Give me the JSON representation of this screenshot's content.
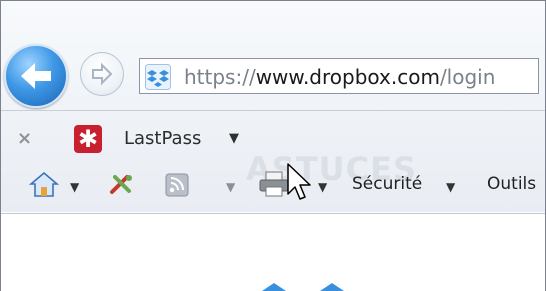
{
  "toolbar": {
    "back_icon": "back-arrow-icon",
    "forward_icon": "forward-arrow-icon",
    "address": {
      "site_icon": "dropbox-icon",
      "url_scheme": "https://",
      "url_host": "www.dropbox.com",
      "url_path": "/login"
    }
  },
  "lastpass_bar": {
    "close": "×",
    "logo_glyph": "✱",
    "label": "LastPass",
    "caret": "▼"
  },
  "command_bar": {
    "home_icon": "home-icon",
    "feeds_icon": "rss-feed-icon",
    "print_icon": "printer-icon",
    "tools_icon": "tools-icon",
    "security_label": "Sécurité",
    "tools_label": "Outils",
    "caret": "▼"
  },
  "watermark": "ASTUCES",
  "colors": {
    "accent_blue": "#3f98e6",
    "lastpass_red": "#c8202f",
    "dropbox_blue": "#3a8fdd"
  }
}
